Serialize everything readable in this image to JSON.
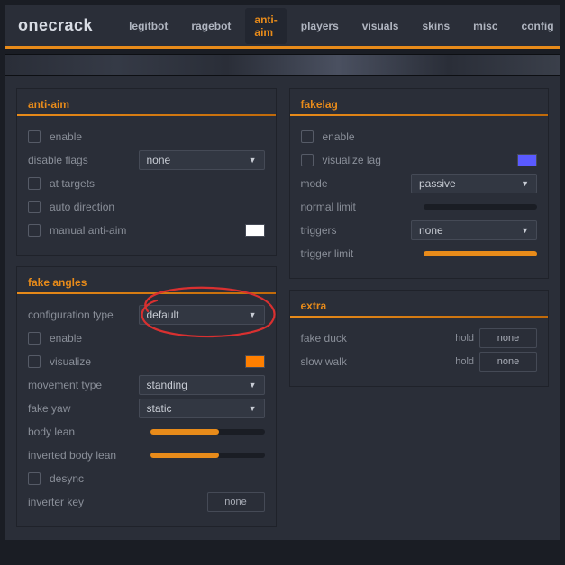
{
  "app": {
    "title": "onecrack"
  },
  "nav": {
    "tabs": [
      "legitbot",
      "ragebot",
      "anti-aim",
      "players",
      "visuals",
      "skins",
      "misc",
      "config"
    ],
    "active": "anti-aim"
  },
  "antiaim": {
    "header": "anti-aim",
    "enable": "enable",
    "disable_flags_label": "disable flags",
    "disable_flags_value": "none",
    "at_targets": "at targets",
    "auto_direction": "auto direction",
    "manual_anti_aim": "manual anti-aim",
    "manual_color": "#ffffff"
  },
  "fake_angles": {
    "header": "fake angles",
    "config_type_label": "configuration type",
    "config_type_value": "default",
    "enable": "enable",
    "visualize": "visualize",
    "visualize_color": "#ff7f00",
    "movement_type_label": "movement type",
    "movement_type_value": "standing",
    "fake_yaw_label": "fake yaw",
    "fake_yaw_value": "static",
    "body_lean_label": "body lean",
    "body_lean_fill": 60,
    "inverted_body_lean_label": "inverted body lean",
    "inverted_body_lean_fill": 60,
    "desync": "desync",
    "inverter_key_label": "inverter key",
    "inverter_key_value": "none"
  },
  "fakelag": {
    "header": "fakelag",
    "enable": "enable",
    "visualize_lag": "visualize lag",
    "visualize_color": "#5a5aff",
    "mode_label": "mode",
    "mode_value": "passive",
    "normal_limit_label": "normal limit",
    "normal_limit_fill": 0,
    "triggers_label": "triggers",
    "triggers_value": "none",
    "trigger_limit_label": "trigger limit",
    "trigger_limit_fill": 100
  },
  "extra": {
    "header": "extra",
    "fake_duck_label": "fake duck",
    "fake_duck_mode": "hold",
    "fake_duck_key": "none",
    "slow_walk_label": "slow walk",
    "slow_walk_mode": "hold",
    "slow_walk_key": "none"
  }
}
